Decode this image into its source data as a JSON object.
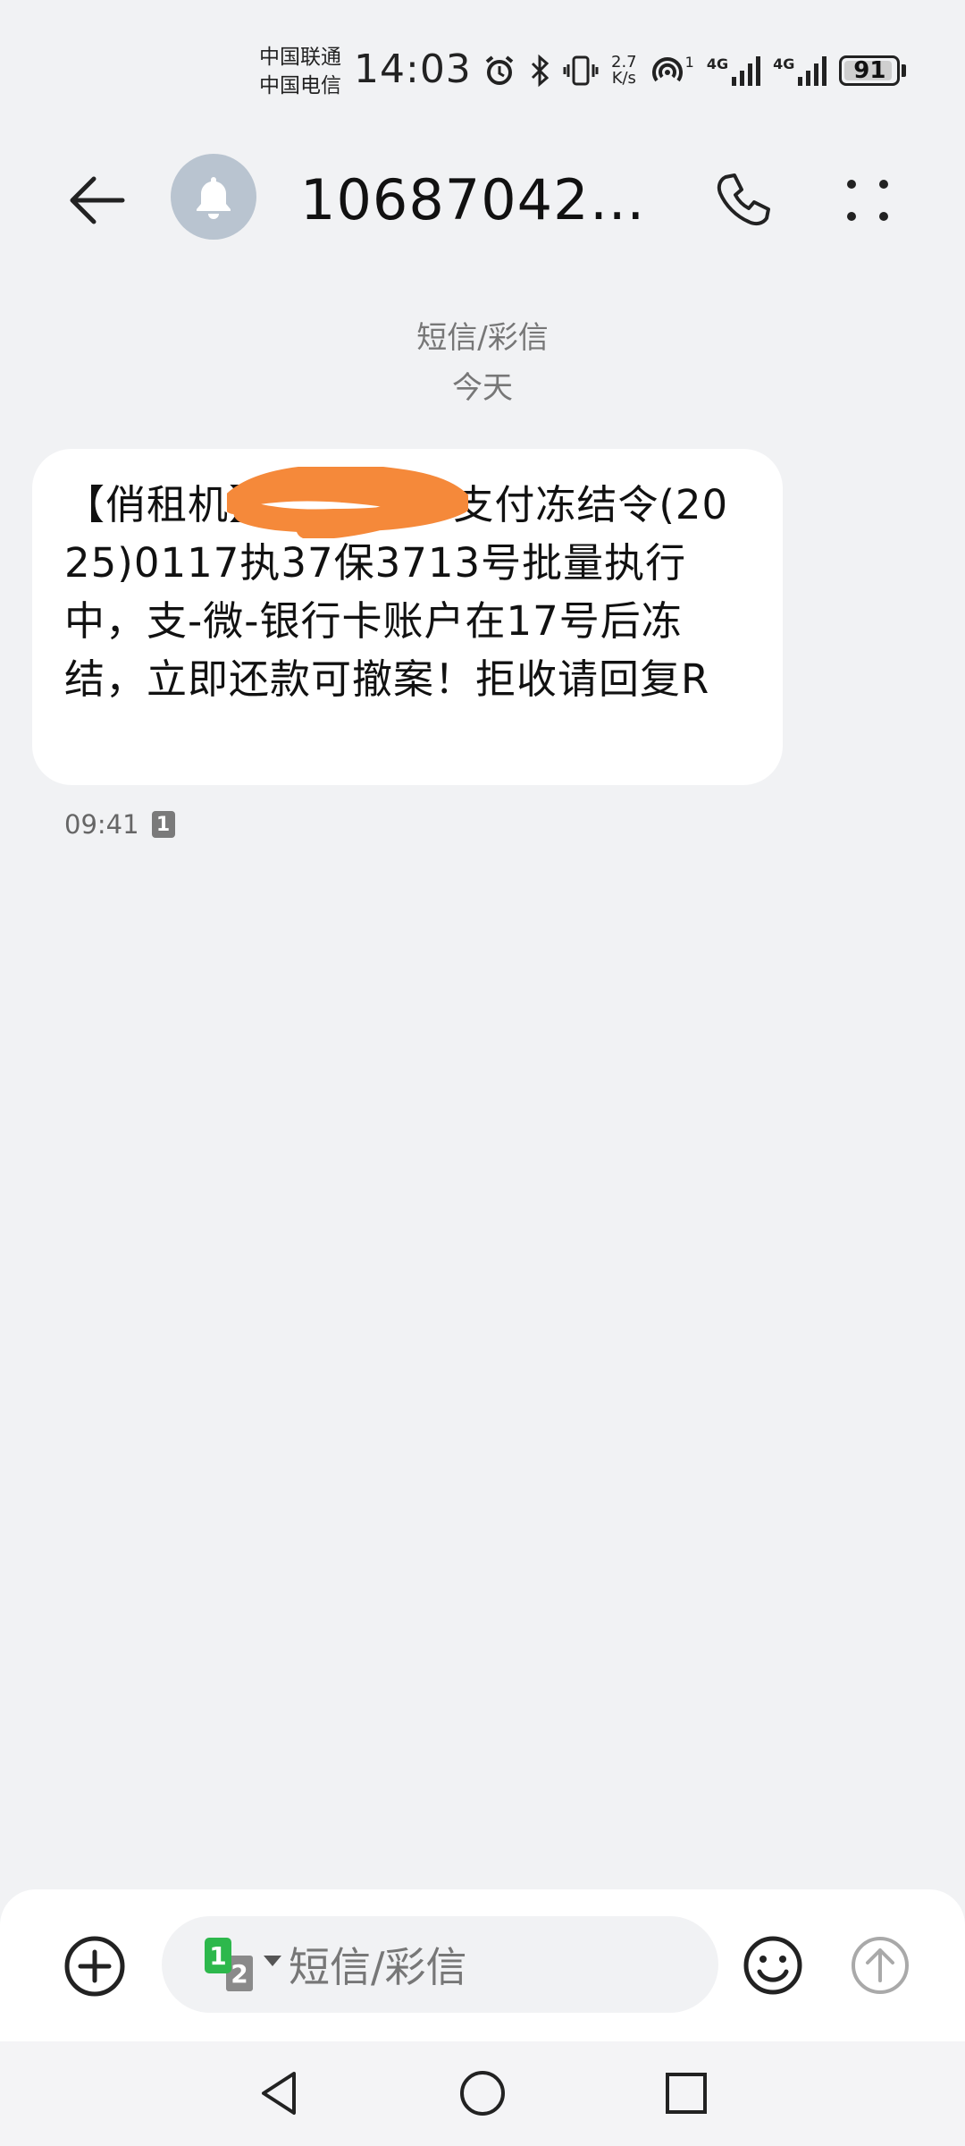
{
  "status_bar": {
    "carrier_1": "中国联通",
    "carrier_2": "中国电信",
    "time": "14:03",
    "net_speed_value": "2.7",
    "net_speed_unit": "K/s",
    "hotspot_count": "1",
    "sim1_network": "4G",
    "sim2_network": "4G",
    "battery": "91"
  },
  "header": {
    "contact": "1068704200..."
  },
  "conversation": {
    "message_type": "短信/彩信",
    "date_label": "今天",
    "messages": [
      {
        "text_prefix": "【俏租机】",
        "text_body": " 支付冻结令(2025)0117执37保3713号批量执行中，支-微-银行卡账户在17号后冻结，立即还款可撤案！拒收请回复R",
        "time": "09:41",
        "sim": "1"
      }
    ]
  },
  "input_bar": {
    "placeholder": "短信/彩信",
    "sim_primary": "1",
    "sim_secondary": "2"
  },
  "colors": {
    "background": "#f1f2f4",
    "bubble": "#ffffff",
    "redaction": "#f5893a",
    "sim_green": "#2db84c",
    "avatar": "#b9c4d0"
  },
  "icons": {
    "back": "arrow-left-icon",
    "avatar": "bell-icon",
    "call": "phone-icon",
    "more": "more-vertical-icon",
    "add": "plus-circle-icon",
    "emoji": "smiley-icon",
    "send": "arrow-up-circle-icon"
  }
}
